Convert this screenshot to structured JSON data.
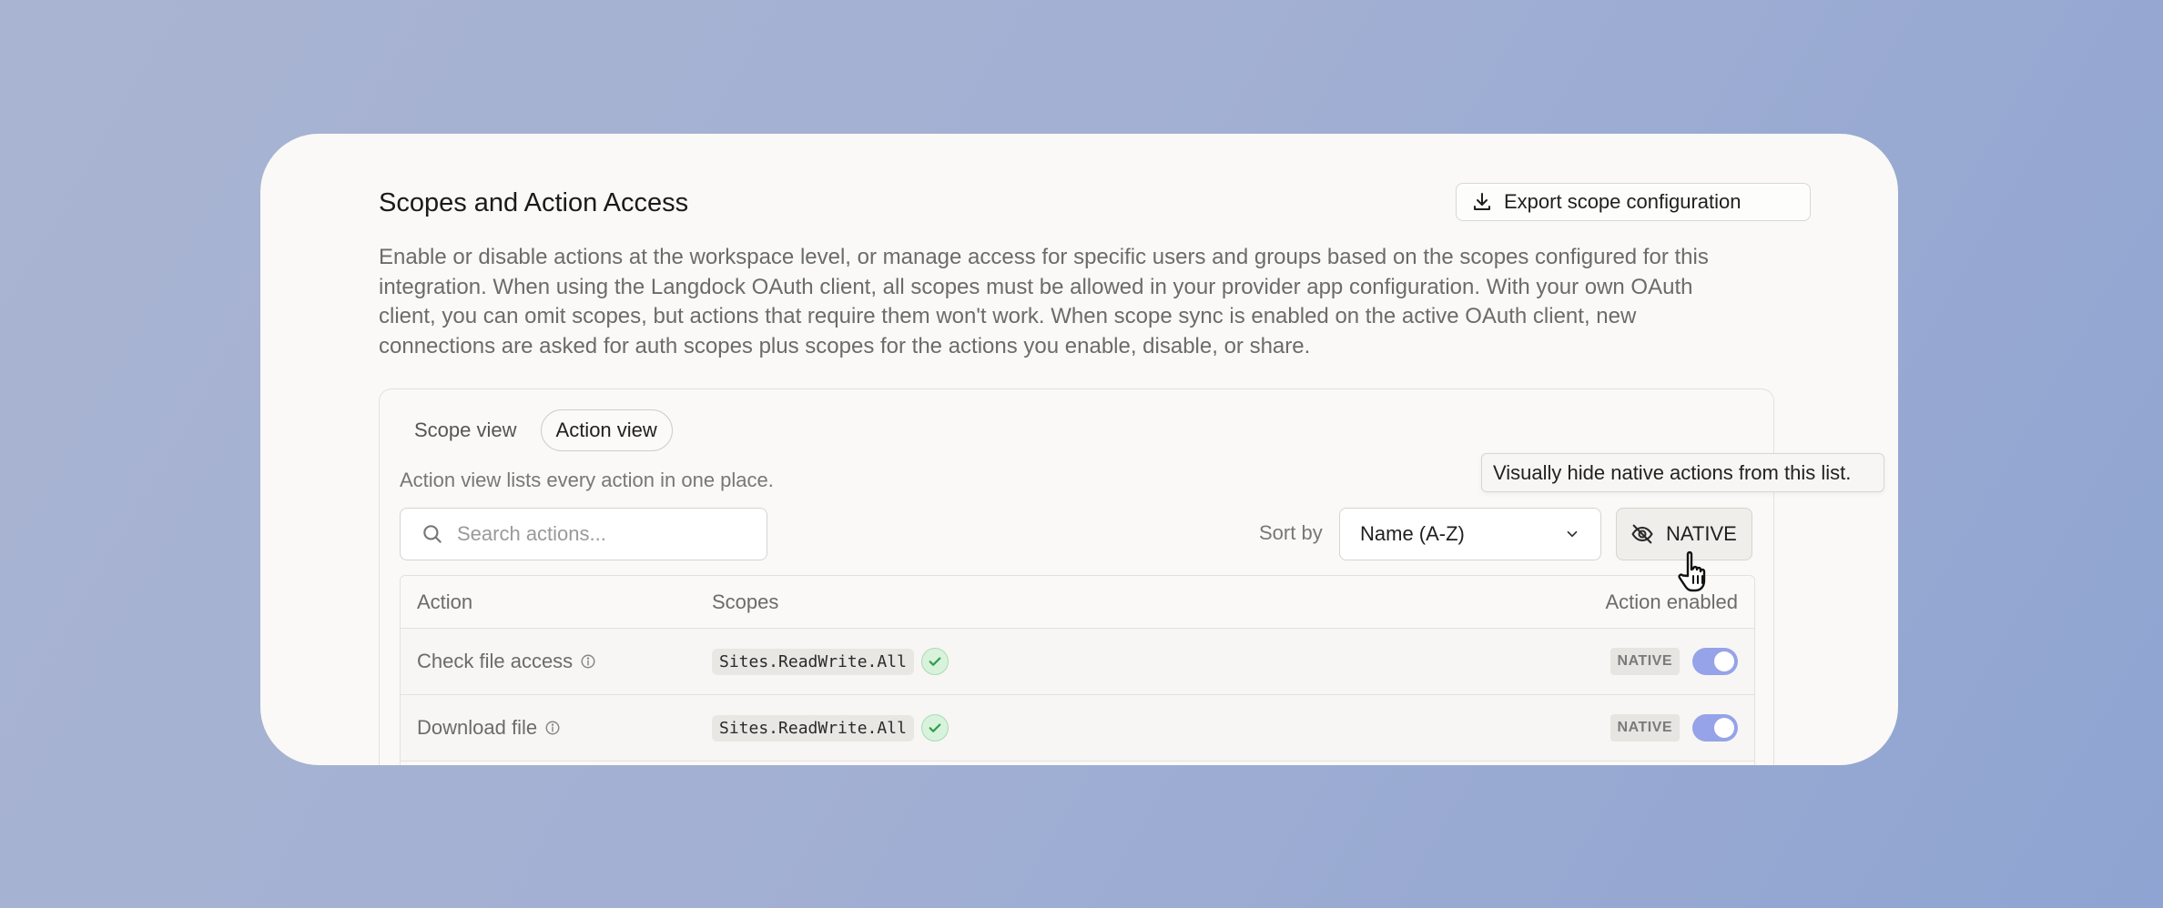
{
  "header": {
    "title": "Scopes and Action Access",
    "export_label": "Export scope configuration"
  },
  "description": "Enable or disable actions at the workspace level, or manage access for specific users and groups based on the scopes configured for this integration. When using the Langdock OAuth client, all scopes must be allowed in your provider app configuration. With your own OAuth client, you can omit scopes, but actions that require them won't work. When scope sync is enabled on the active OAuth client, new connections are asked for auth scopes plus scopes for the actions you enable, disable, or share.",
  "tabs": [
    {
      "label": "Scope view",
      "active": false
    },
    {
      "label": "Action view",
      "active": true
    }
  ],
  "hint": "Action view lists every action in one place.",
  "search": {
    "placeholder": "Search actions..."
  },
  "sort": {
    "label": "Sort by",
    "value": "Name (A-Z)"
  },
  "native_button": {
    "label": "NATIVE"
  },
  "tooltip": "Visually hide native actions from this list.",
  "table": {
    "headers": {
      "action": "Action",
      "scopes": "Scopes",
      "enabled": "Action enabled"
    },
    "rows": [
      {
        "action": "Check file access",
        "scope": "Sites.ReadWrite.All",
        "badge": "NATIVE",
        "enabled": true
      },
      {
        "action": "Download file",
        "scope": "Sites.ReadWrite.All",
        "badge": "NATIVE",
        "enabled": true
      }
    ]
  },
  "colors": {
    "toggle_on": "#96a3e8",
    "check_bg": "#d8f2dc",
    "check_icon": "#2f9e4a"
  },
  "icons": [
    "download-icon",
    "search-icon",
    "chevron-down-icon",
    "eye-off-icon",
    "info-icon",
    "check-icon",
    "hand-cursor-icon"
  ]
}
